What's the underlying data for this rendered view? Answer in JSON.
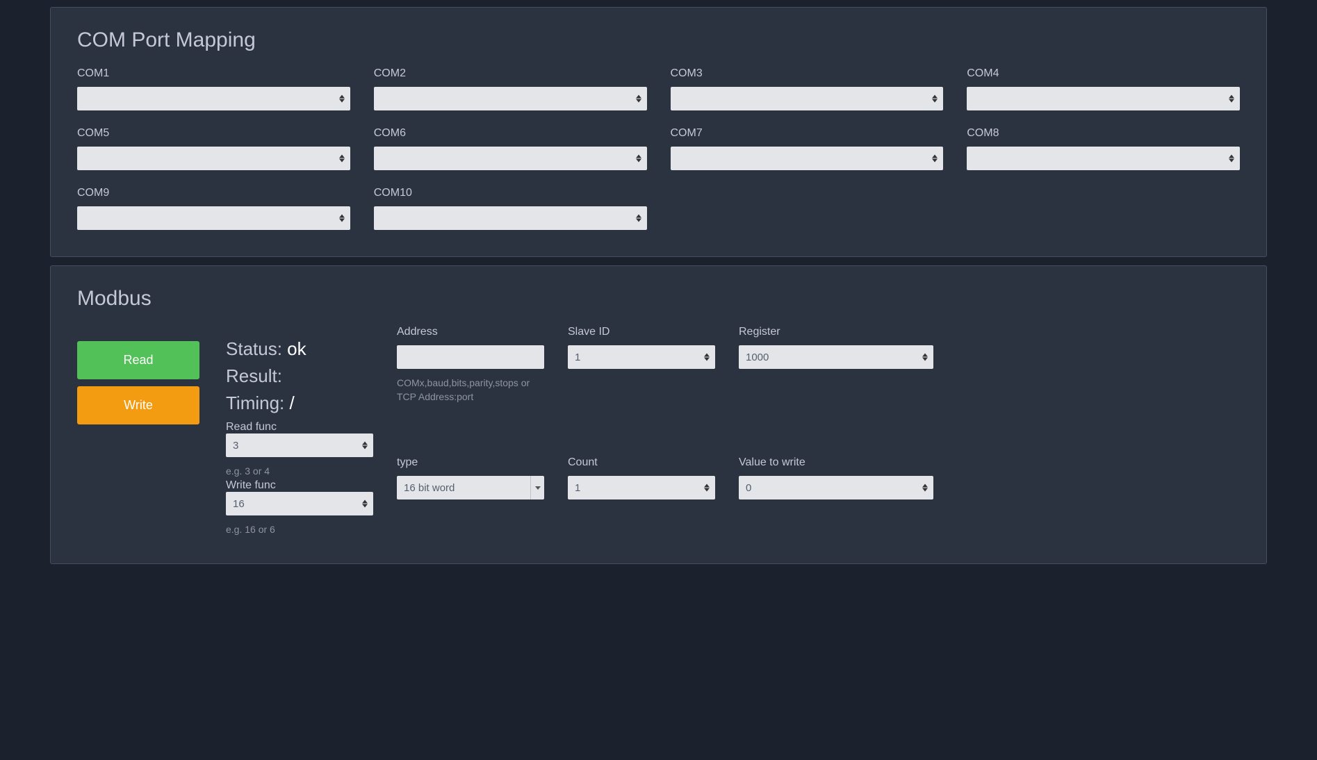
{
  "com_mapping": {
    "title": "COM Port Mapping",
    "ports": [
      {
        "label": "COM1",
        "value": ""
      },
      {
        "label": "COM2",
        "value": ""
      },
      {
        "label": "COM3",
        "value": ""
      },
      {
        "label": "COM4",
        "value": ""
      },
      {
        "label": "COM5",
        "value": ""
      },
      {
        "label": "COM6",
        "value": ""
      },
      {
        "label": "COM7",
        "value": ""
      },
      {
        "label": "COM8",
        "value": ""
      },
      {
        "label": "COM9",
        "value": ""
      },
      {
        "label": "COM10",
        "value": ""
      }
    ]
  },
  "modbus": {
    "title": "Modbus",
    "read_label": "Read",
    "write_label": "Write",
    "address_label": "Address",
    "address_value": "",
    "address_help": "COMx,baud,bits,parity,stops or TCP Address:port",
    "slave_label": "Slave ID",
    "slave_value": "1",
    "register_label": "Register",
    "register_value": "1000",
    "type_label": "type",
    "type_value": "16 bit word",
    "count_label": "Count",
    "count_value": "1",
    "valwrite_label": "Value to write",
    "valwrite_value": "0",
    "status_label": "Status: ",
    "status_value": "ok",
    "result_label": "Result:",
    "result_value": "",
    "timing_label": "Timing: ",
    "timing_value": "/",
    "readfunc_label": "Read func",
    "readfunc_value": "3",
    "readfunc_help": "e.g. 3 or 4",
    "writefunc_label": "Write func",
    "writefunc_value": "16",
    "writefunc_help": "e.g. 16 or 6"
  }
}
